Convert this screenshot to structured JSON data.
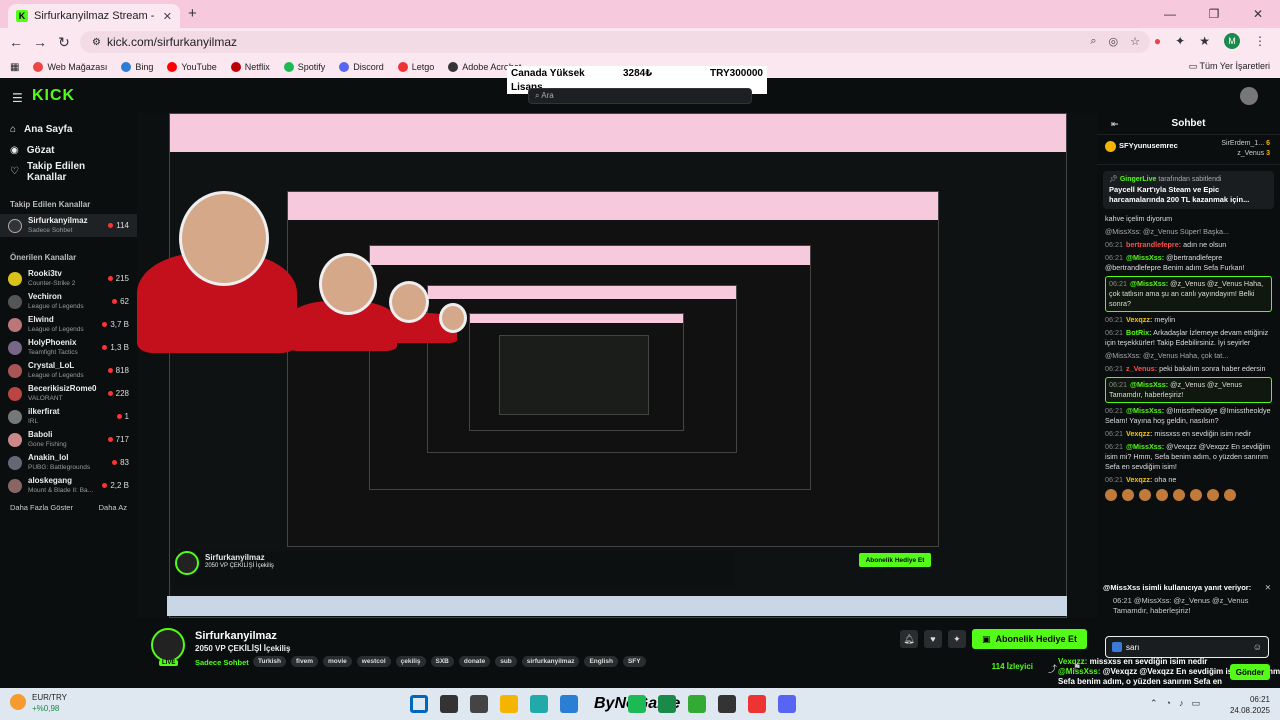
{
  "browser": {
    "tab_title": "Sirfurkanyilmaz Stream - Watch",
    "tab_close": "✕",
    "new_tab": "+",
    "url": "kick.com/sirfurkanyilmaz",
    "win_min": "—",
    "win_max": "❐",
    "win_close": "✕",
    "profile_letter": "M",
    "bookmarks": [
      {
        "label": "Web Mağazası",
        "color": "#e44"
      },
      {
        "label": "Bing",
        "color": "#2a7fd5"
      },
      {
        "label": "YouTube",
        "color": "#f00"
      },
      {
        "label": "Netflix",
        "color": "#b00"
      },
      {
        "label": "Spotify",
        "color": "#1db954"
      },
      {
        "label": "Discord",
        "color": "#5865f2"
      },
      {
        "label": "Letgo",
        "color": "#e33"
      },
      {
        "label": "Adobe Acrobat",
        "color": "#333"
      }
    ],
    "bookmarks_all": "Tüm Yer İşaretleri"
  },
  "ticker": {
    "a": "Canada Yüksek",
    "b": "3284₺",
    "c": "TRY300000",
    "l": "Lisans"
  },
  "site": {
    "logo": "KICK",
    "search_placeholder": "Ara"
  },
  "sidebar": {
    "nav": [
      "Ana Sayfa",
      "Gözat",
      "Takip Edilen Kanallar"
    ],
    "followed_head": "Takip Edilen Kanallar",
    "followed": [
      {
        "name": "Sirfurkanyilmaz",
        "game": "Sadece Sohbet",
        "viewers": "114"
      }
    ],
    "recommended_head": "Önerilen Kanallar",
    "recommended": [
      {
        "name": "Rooki3tv",
        "game": "Counter-Strike 2",
        "viewers": "215",
        "color": "#d9c21a"
      },
      {
        "name": "Vechiron",
        "game": "League of Legends",
        "viewers": "62",
        "color": "#555"
      },
      {
        "name": "Elwind",
        "game": "League of Legends",
        "viewers": "3,7 B",
        "color": "#b77"
      },
      {
        "name": "HolyPhoenix",
        "game": "Teamfight Tactics",
        "viewers": "1,3 B",
        "color": "#768"
      },
      {
        "name": "Crystal_LoL",
        "game": "League of Legends",
        "viewers": "818",
        "color": "#a55"
      },
      {
        "name": "BecerikisizRome0",
        "game": "VALORANT",
        "viewers": "228",
        "color": "#b44"
      },
      {
        "name": "ilkerfirat",
        "game": "IRL",
        "viewers": "1",
        "color": "#777"
      },
      {
        "name": "Baboli",
        "game": "Gone Fishing",
        "viewers": "717",
        "color": "#c88"
      },
      {
        "name": "Anakin_lol",
        "game": "PUBG: Battlegrounds",
        "viewers": "83",
        "color": "#667"
      },
      {
        "name": "aloskegang",
        "game": "Mount & Blade II: Ba...",
        "viewers": "2,2 B",
        "color": "#866"
      }
    ],
    "more": "Daha Fazla Göster",
    "less": "Daha Az"
  },
  "stream": {
    "channel": "Sirfurkanyilmaz",
    "title": "2050 VP ÇEKİLİŞİ İçekiliş",
    "category": "Sadece Sohbet",
    "live": "LIVE",
    "tags": [
      "Turkish",
      "fivem",
      "movie",
      "westcol",
      "çekiliş",
      "SXB",
      "donate",
      "sub",
      "sirfurkanyilmaz",
      "English",
      "SFY"
    ],
    "gift_label": "Abonelik Hediye Et",
    "viewers": "114 İzleyici"
  },
  "chat": {
    "title": "Sohbet",
    "leader_user": "SFYyunusemrec",
    "leader_r1": "SirErdem_1...",
    "leader_r1_count": "6",
    "leader_r2": "z_Venus",
    "leader_r2_count": "3",
    "pinned_by_user": "GingerLive",
    "pinned_by_suffix": "tarafından sabitlendi",
    "pinned_text": "Paycell Kart'ıyla Steam ve Epic harcamalarında 200 TL kazanmak için...",
    "messages": [
      {
        "t": "",
        "u": "",
        "c": "",
        "text": "kahve içelim diyorum",
        "hl": false
      },
      {
        "t": "",
        "u": "",
        "c": "g",
        "text": "@MissXss: @z_Venus Süper! Başka...",
        "hl": false
      },
      {
        "t": "06:21",
        "u": "bertrandlefepre:",
        "c": "r",
        "text": "adın ne olsun",
        "hl": false
      },
      {
        "t": "06:21",
        "u": "@MissXss:",
        "c": "",
        "text": "@bertrandlefepre @bertrandlefepre Benim adım Sefa Furkan!",
        "hl": false
      },
      {
        "t": "06:21",
        "u": "@MissXss:",
        "c": "",
        "text": "@z_Venus @z_Venus Haha, çok tatlısın ama şu an canlı yayındayım! Belki sonra?",
        "hl": true
      },
      {
        "t": "06:21",
        "u": "Vexqzz:",
        "c": "y",
        "text": "meylin",
        "hl": false
      },
      {
        "t": "06:21",
        "u": "BotRix:",
        "c": "",
        "text": "Arkadaşlar İzlemeye devam ettiğiniz için teşekkürler! Takip Edebilirsiniz. İyi seyirler",
        "hl": false
      },
      {
        "t": "",
        "u": "",
        "c": "g",
        "text": "@MissXss: @z_Venus Haha, çok tat...",
        "hl": false
      },
      {
        "t": "06:21",
        "u": "z_Venus:",
        "c": "r",
        "text": "peki bakalım sonra haber edersin",
        "hl": false
      },
      {
        "t": "06:21",
        "u": "@MissXss:",
        "c": "",
        "text": "@z_Venus @z_Venus Tamamdır, haberleşiriz!",
        "hl": true
      },
      {
        "t": "06:21",
        "u": "@MissXss:",
        "c": "",
        "text": "@Imisstheoldye @Imisstheoldye Selam! Yayına hoş geldin, nasılsın?",
        "hl": false
      },
      {
        "t": "06:21",
        "u": "Vexqzz:",
        "c": "y",
        "text": "missxss en sevdiğin isim nedir",
        "hl": false
      },
      {
        "t": "06:21",
        "u": "@MissXss:",
        "c": "",
        "text": "@Vexqzz @Vexqzz En sevdiğim isim mi? Hmm, Sefa benim adım, o yüzden sanırım Sefa en sevdiğim isim!",
        "hl": false
      },
      {
        "t": "06:21",
        "u": "Vexqzz:",
        "c": "y",
        "text": "oha ne",
        "hl": false
      }
    ],
    "reply_title": "@MissXss isimli kullanıcıya yanıt veriyor:",
    "reply_quote": "06:21 @MissXss: @z_Venus @z_Venus Tamamdır, haberleşiriz!",
    "input_value": "sarı",
    "send_label": "Gönder",
    "overflow_line1_user": "Vexqzz:",
    "overflow_line1_text": "missxss en sevdiğin isim nedir",
    "overflow_line2_user": "@MissXss:",
    "overflow_line2_text": "@Vexqzz @Vexqzz En sevdiğim isim mi? Hmm, Sefa benim adım, o yüzden sanırım Sefa en"
  },
  "taskbar": {
    "weather_pair": "EUR/TRY",
    "weather_change": "+%0,98",
    "brand": "ByNoGame",
    "time": "06:21",
    "date": "24.08.2025",
    "icon_colors": [
      "#0067c0",
      "#333",
      "#444",
      "#f5b400",
      "#2aa",
      "#2a7fd5",
      "#1db954",
      "#1a8a4a",
      "#3a3",
      "#333",
      "#e33",
      "#5865f2"
    ]
  }
}
